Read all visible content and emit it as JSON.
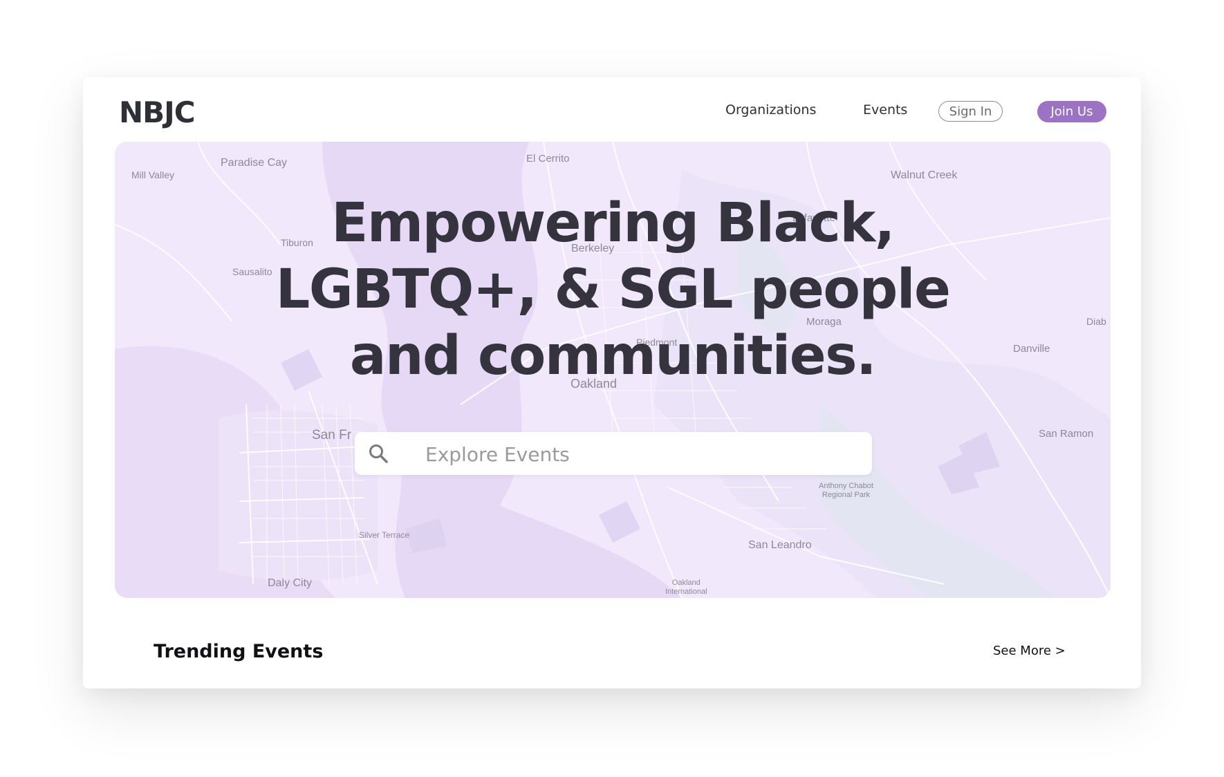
{
  "header": {
    "logo": "NBJC",
    "nav": {
      "organizations": "Organizations",
      "events": "Events"
    },
    "sign_in": "Sign In",
    "join_us": "Join Us"
  },
  "hero": {
    "headline_lines": [
      "Empowering Black,",
      "LGBTQ+, & SGL people",
      "and communities."
    ],
    "search": {
      "placeholder": "Explore Events",
      "value": "",
      "icon": "search-icon"
    },
    "map_labels": {
      "mill_valley": "Mill Valley",
      "paradise_cay": "Paradise Cay",
      "el_cerrito": "El Cerrito",
      "walnut_creek": "Walnut Creek",
      "lafayette": "Lafayette",
      "tiburon": "Tiburon",
      "berkeley": "Berkeley",
      "sausalito": "Sausalito",
      "moraga": "Moraga",
      "piedmont": "Piedmont",
      "diablo": "Diab",
      "danville": "Danville",
      "oakland": "Oakland",
      "san_francisco": "San Fr",
      "san_ramon": "San Ramon",
      "anthony_chabot": "Anthony Chabot\nRegional Park",
      "silver_terrace": "Silver Terrace",
      "san_leandro": "San Leandro",
      "daly_city": "Daly City",
      "oakland_intl": "Oakland\nInternational"
    }
  },
  "trending": {
    "title": "Trending Events",
    "see_more": "See More >"
  },
  "colors": {
    "accent": "#9b72c4",
    "map_bg": "#efe6f9",
    "text_dark": "#35333d"
  }
}
